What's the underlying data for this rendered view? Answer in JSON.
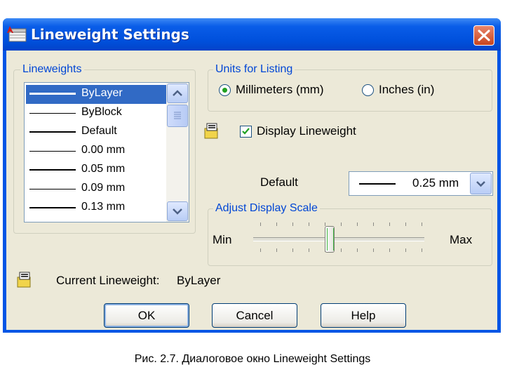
{
  "window": {
    "title": "Lineweight Settings"
  },
  "lineweights_group": {
    "label": "Lineweights"
  },
  "lineweights_list": {
    "items": [
      {
        "label": "ByLayer"
      },
      {
        "label": "ByBlock"
      },
      {
        "label": "Default"
      },
      {
        "label": "0.00 mm"
      },
      {
        "label": "0.05 mm"
      },
      {
        "label": "0.09 mm"
      },
      {
        "label": "0.13 mm"
      }
    ],
    "selected": "ByLayer"
  },
  "units_group": {
    "label": "Units for Listing",
    "millimeters_label": "Millimeters (mm)",
    "inches_label": "Inches (in)",
    "selected": "Millimeters (mm)"
  },
  "display_lineweight": {
    "label": "Display Lineweight",
    "checked": true
  },
  "default_setting": {
    "label": "Default",
    "value": "0.25 mm"
  },
  "display_scale_group": {
    "label": "Adjust Display Scale",
    "min_label": "Min",
    "max_label": "Max",
    "tick_count": 11,
    "thumb_fraction": 0.43
  },
  "current_lineweight": {
    "label": "Current Lineweight:",
    "value": "ByLayer"
  },
  "buttons": {
    "ok": "OK",
    "cancel": "Cancel",
    "help": "Help"
  },
  "caption": "Рис. 2.7. Диалоговое окно Lineweight Settings",
  "colors": {
    "titlebar": "#0a5de8",
    "client_bg": "#ece9d8",
    "group_label": "#0046d5",
    "selection": "#316ac5",
    "close_button": "#c9451f",
    "radio_dot": "#21a121"
  },
  "icons": [
    "autocad-app-icon",
    "close-icon",
    "scroll-up-icon",
    "scroll-down-icon",
    "dropdown-arrow-icon",
    "lineweight-preview-icon"
  ]
}
